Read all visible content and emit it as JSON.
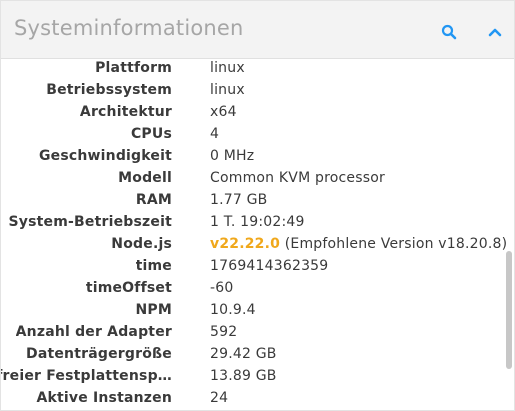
{
  "header": {
    "title": "Systeminformationen",
    "search_icon": "search-icon",
    "collapse_icon": "chevron-up-icon",
    "accent": "#2196f3"
  },
  "rows": [
    {
      "label": "Plattform",
      "value": "linux"
    },
    {
      "label": "Betriebssystem",
      "value": "linux"
    },
    {
      "label": "Architektur",
      "value": "x64"
    },
    {
      "label": "CPUs",
      "value": "4"
    },
    {
      "label": "Geschwindigkeit",
      "value": "0 MHz"
    },
    {
      "label": "Modell",
      "value": "Common KVM processor"
    },
    {
      "label": "RAM",
      "value": "1.77 GB"
    },
    {
      "label": "System-Betriebszeit",
      "value": "1 T. 19:02:49"
    },
    {
      "label": "Node.js",
      "value_highlight": "v22.22.0",
      "value_note": "(Empfohlene Version v18.20.8)",
      "highlight_color": "#f0a81c"
    },
    {
      "label": "time",
      "value": "1769414362359"
    },
    {
      "label": "timeOffset",
      "value": "-60"
    },
    {
      "label": "NPM",
      "value": "10.9.4"
    },
    {
      "label": "Anzahl der Adapter",
      "value": "592"
    },
    {
      "label": "Datenträgergröße",
      "value": "29.42 GB"
    },
    {
      "label": "freier Festplattensp…",
      "value": "13.89 GB"
    },
    {
      "label": "Aktive Instanzen",
      "value": "24"
    }
  ]
}
